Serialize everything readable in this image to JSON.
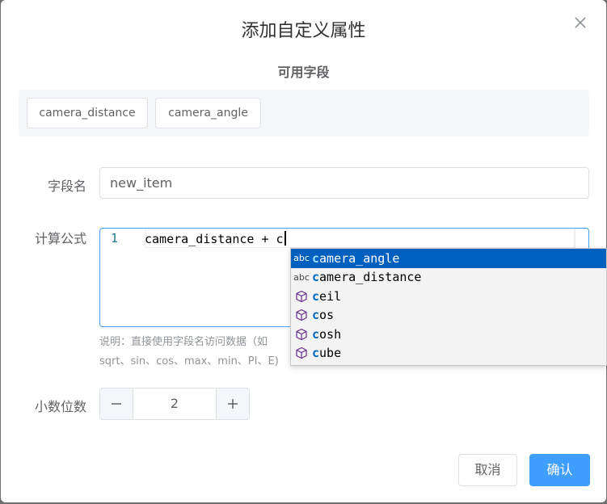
{
  "dialog": {
    "title": "添加自定义属性",
    "available_fields_heading": "可用字段",
    "available_fields": [
      "camera_distance",
      "camera_angle"
    ]
  },
  "form": {
    "field_name_label": "字段名",
    "field_name_value": "new_item",
    "formula_label": "计算公式",
    "editor": {
      "line_number": "1",
      "code": "camera_distance + c"
    },
    "hint_line1": "说明：直接使用字段名访问数据（如",
    "hint_line2": "sqrt、sin、cos、max、min、PI、E)",
    "decimal_label": "小数位数",
    "decimal_value": "2",
    "minus_symbol": "−",
    "plus_symbol": "+"
  },
  "autocomplete": {
    "items": [
      {
        "kind": "abc",
        "match": "c",
        "rest": "amera_angle",
        "selected": true
      },
      {
        "kind": "abc",
        "match": "c",
        "rest": "amera_distance",
        "selected": false
      },
      {
        "kind": "function",
        "match": "c",
        "rest": "eil",
        "selected": false
      },
      {
        "kind": "function",
        "match": "c",
        "rest": "os",
        "selected": false
      },
      {
        "kind": "function",
        "match": "c",
        "rest": "osh",
        "selected": false
      },
      {
        "kind": "function",
        "match": "c",
        "rest": "ube",
        "selected": false
      }
    ],
    "kind_label_abc": "abc"
  },
  "footer": {
    "cancel_label": "取消",
    "confirm_label": "确认"
  },
  "colors": {
    "primary": "#409eff",
    "suggest_selected": "#0060c0",
    "function_icon": "#652d90"
  }
}
